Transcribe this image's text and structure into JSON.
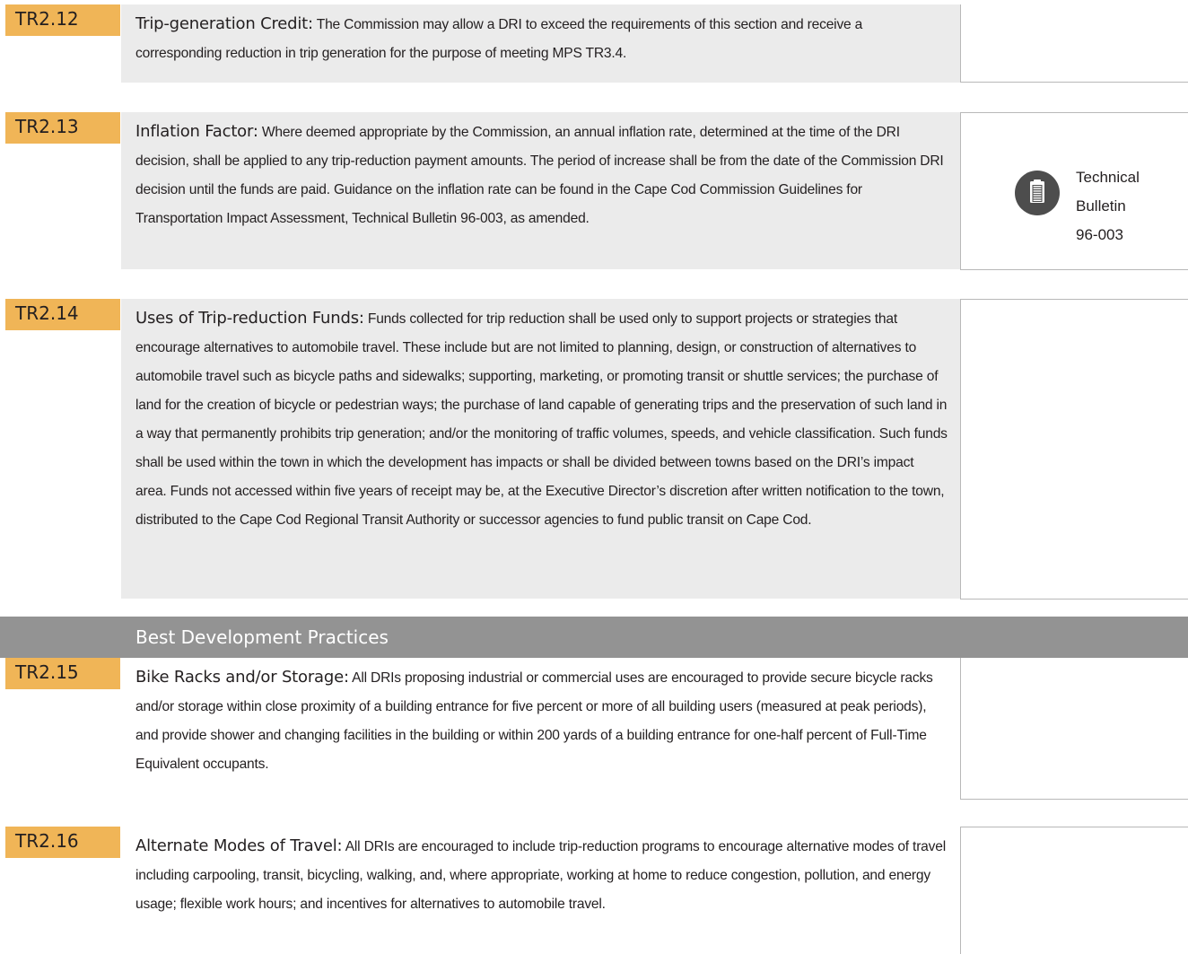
{
  "sections": {
    "tr2_12": {
      "code": "TR2.12",
      "title": "Trip-generation Credit:",
      "body": "The Commission may allow a DRI to exceed the requirements of this section and receive a corresponding reduction in trip generation for the purpose of meeting MPS TR3.4."
    },
    "tr2_13": {
      "code": "TR2.13",
      "title": "Inflation Factor:",
      "body": "Where deemed appropriate by the Commission, an annual inflation rate, determined at the time of the DRI decision, shall be applied to any trip-reduction payment amounts. The period of increase shall be from the date of the Commission DRI decision until the funds are paid. Guidance on the inflation rate can be found in the Cape Cod Commission Guidelines for Transportation Impact Assessment, Technical Bulletin 96-003, as amended.",
      "sidebar": {
        "icon": "document-icon",
        "lines": [
          "Technical",
          "Bulletin",
          "96-003"
        ]
      }
    },
    "tr2_14": {
      "code": "TR2.14",
      "title": "Uses of Trip-reduction Funds:",
      "body": "Funds collected for trip reduction shall be used only to support projects or strategies that encourage alternatives to automobile travel. These include but are not limited to planning, design, or construction of alternatives to automobile travel such as bicycle paths and sidewalks; supporting, marketing, or promoting transit or shuttle services; the purchase of land for the creation of bicycle or pedestrian ways; the purchase of land capable of generating trips and the preservation of such land in a way that permanently prohibits trip generation; and/or the monitoring of traffic volumes, speeds, and vehicle classification. Such funds shall be used within the town in which the development has impacts or shall be divided between towns based on the DRI’s impact area. Funds not accessed within five years of receipt may be, at the Executive Director’s discretion after written notification to the town, distributed to the Cape Cod Regional Transit Authority or successor agencies to fund public transit on Cape Cod."
    },
    "best_practices": {
      "heading": "Best Development Practices"
    },
    "tr2_15": {
      "code": "TR2.15",
      "title": "Bike Racks and/or Storage:",
      "body": "All DRIs proposing industrial or commercial uses are encouraged to provide secure bicycle racks and/or storage within close proximity of a building entrance for five percent or more of all building users (measured at peak periods), and provide shower and changing facilities in the building or within 200 yards of a building entrance for one-half percent of Full-Time Equivalent occupants."
    },
    "tr2_16": {
      "code": "TR2.16",
      "title": "Alternate Modes of Travel:",
      "body": "All DRIs are encouraged to include trip-reduction programs to encourage alternative modes of travel including carpooling, transit, bicycling, walking, and, where appropriate, working at home to reduce congestion, pollution, and energy usage; flexible work hours; and incentives for alternatives to automobile travel."
    }
  },
  "colors": {
    "code_tab": "#f0b557",
    "content_bg": "#ebebeb",
    "band_bg": "#939393",
    "icon_bg": "#4d4d4d"
  }
}
